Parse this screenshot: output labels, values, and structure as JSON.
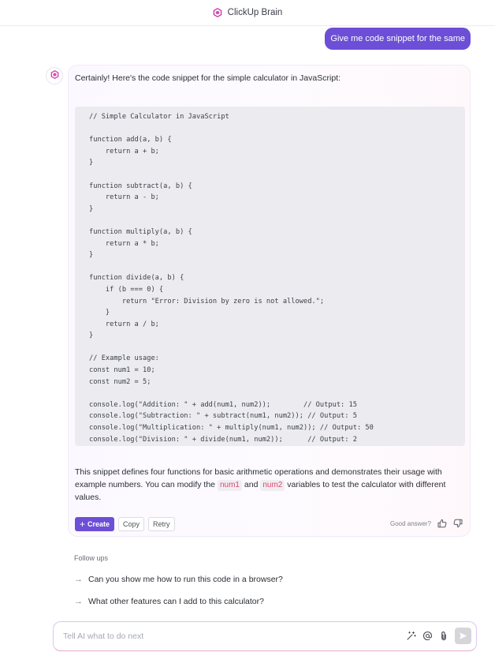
{
  "header": {
    "title": "ClickUp Brain",
    "icon": "clickup-brain-icon"
  },
  "conversation": {
    "user_message": "Give me code snippet for the same",
    "ai": {
      "avatar_icon": "clickup-brain-icon",
      "intro": "Certainly! Here's the code snippet for the simple calculator in JavaScript:",
      "code": "// Simple Calculator in JavaScript\n\nfunction add(a, b) {\n    return a + b;\n}\n\nfunction subtract(a, b) {\n    return a - b;\n}\n\nfunction multiply(a, b) {\n    return a * b;\n}\n\nfunction divide(a, b) {\n    if (b === 0) {\n        return \"Error: Division by zero is not allowed.\";\n    }\n    return a / b;\n}\n\n// Example usage:\nconst num1 = 10;\nconst num2 = 5;\n\nconsole.log(\"Addition: \" + add(num1, num2));        // Output: 15\nconsole.log(\"Subtraction: \" + subtract(num1, num2)); // Output: 5\nconsole.log(\"Multiplication: \" + multiply(num1, num2)); // Output: 50\nconsole.log(\"Division: \" + divide(num1, num2));      // Output: 2",
      "summary": {
        "part1": "This snippet defines four functions for basic arithmetic operations and demonstrates their usage with example numbers. You can modify the ",
        "code1": "num1",
        "part2": " and ",
        "code2": "num2",
        "part3": " variables to test the calculator with different values."
      },
      "actions": {
        "create": "Create",
        "copy": "Copy",
        "retry": "Retry"
      },
      "feedback": {
        "question": "Good answer?"
      }
    }
  },
  "followups": {
    "title": "Follow ups",
    "items": [
      {
        "label": "Can you show me how to run this code in a browser?"
      },
      {
        "label": "What other features can I add to this calculator?"
      }
    ]
  },
  "composer": {
    "placeholder": "Tell AI what to do next",
    "value": "",
    "tools": [
      "magic-wand-icon",
      "mention-icon",
      "attachment-icon",
      "send-icon"
    ]
  },
  "colors": {
    "accent": "#6c4fd6",
    "inline_code_text": "#d9486b",
    "code_background": "#ececf0"
  }
}
